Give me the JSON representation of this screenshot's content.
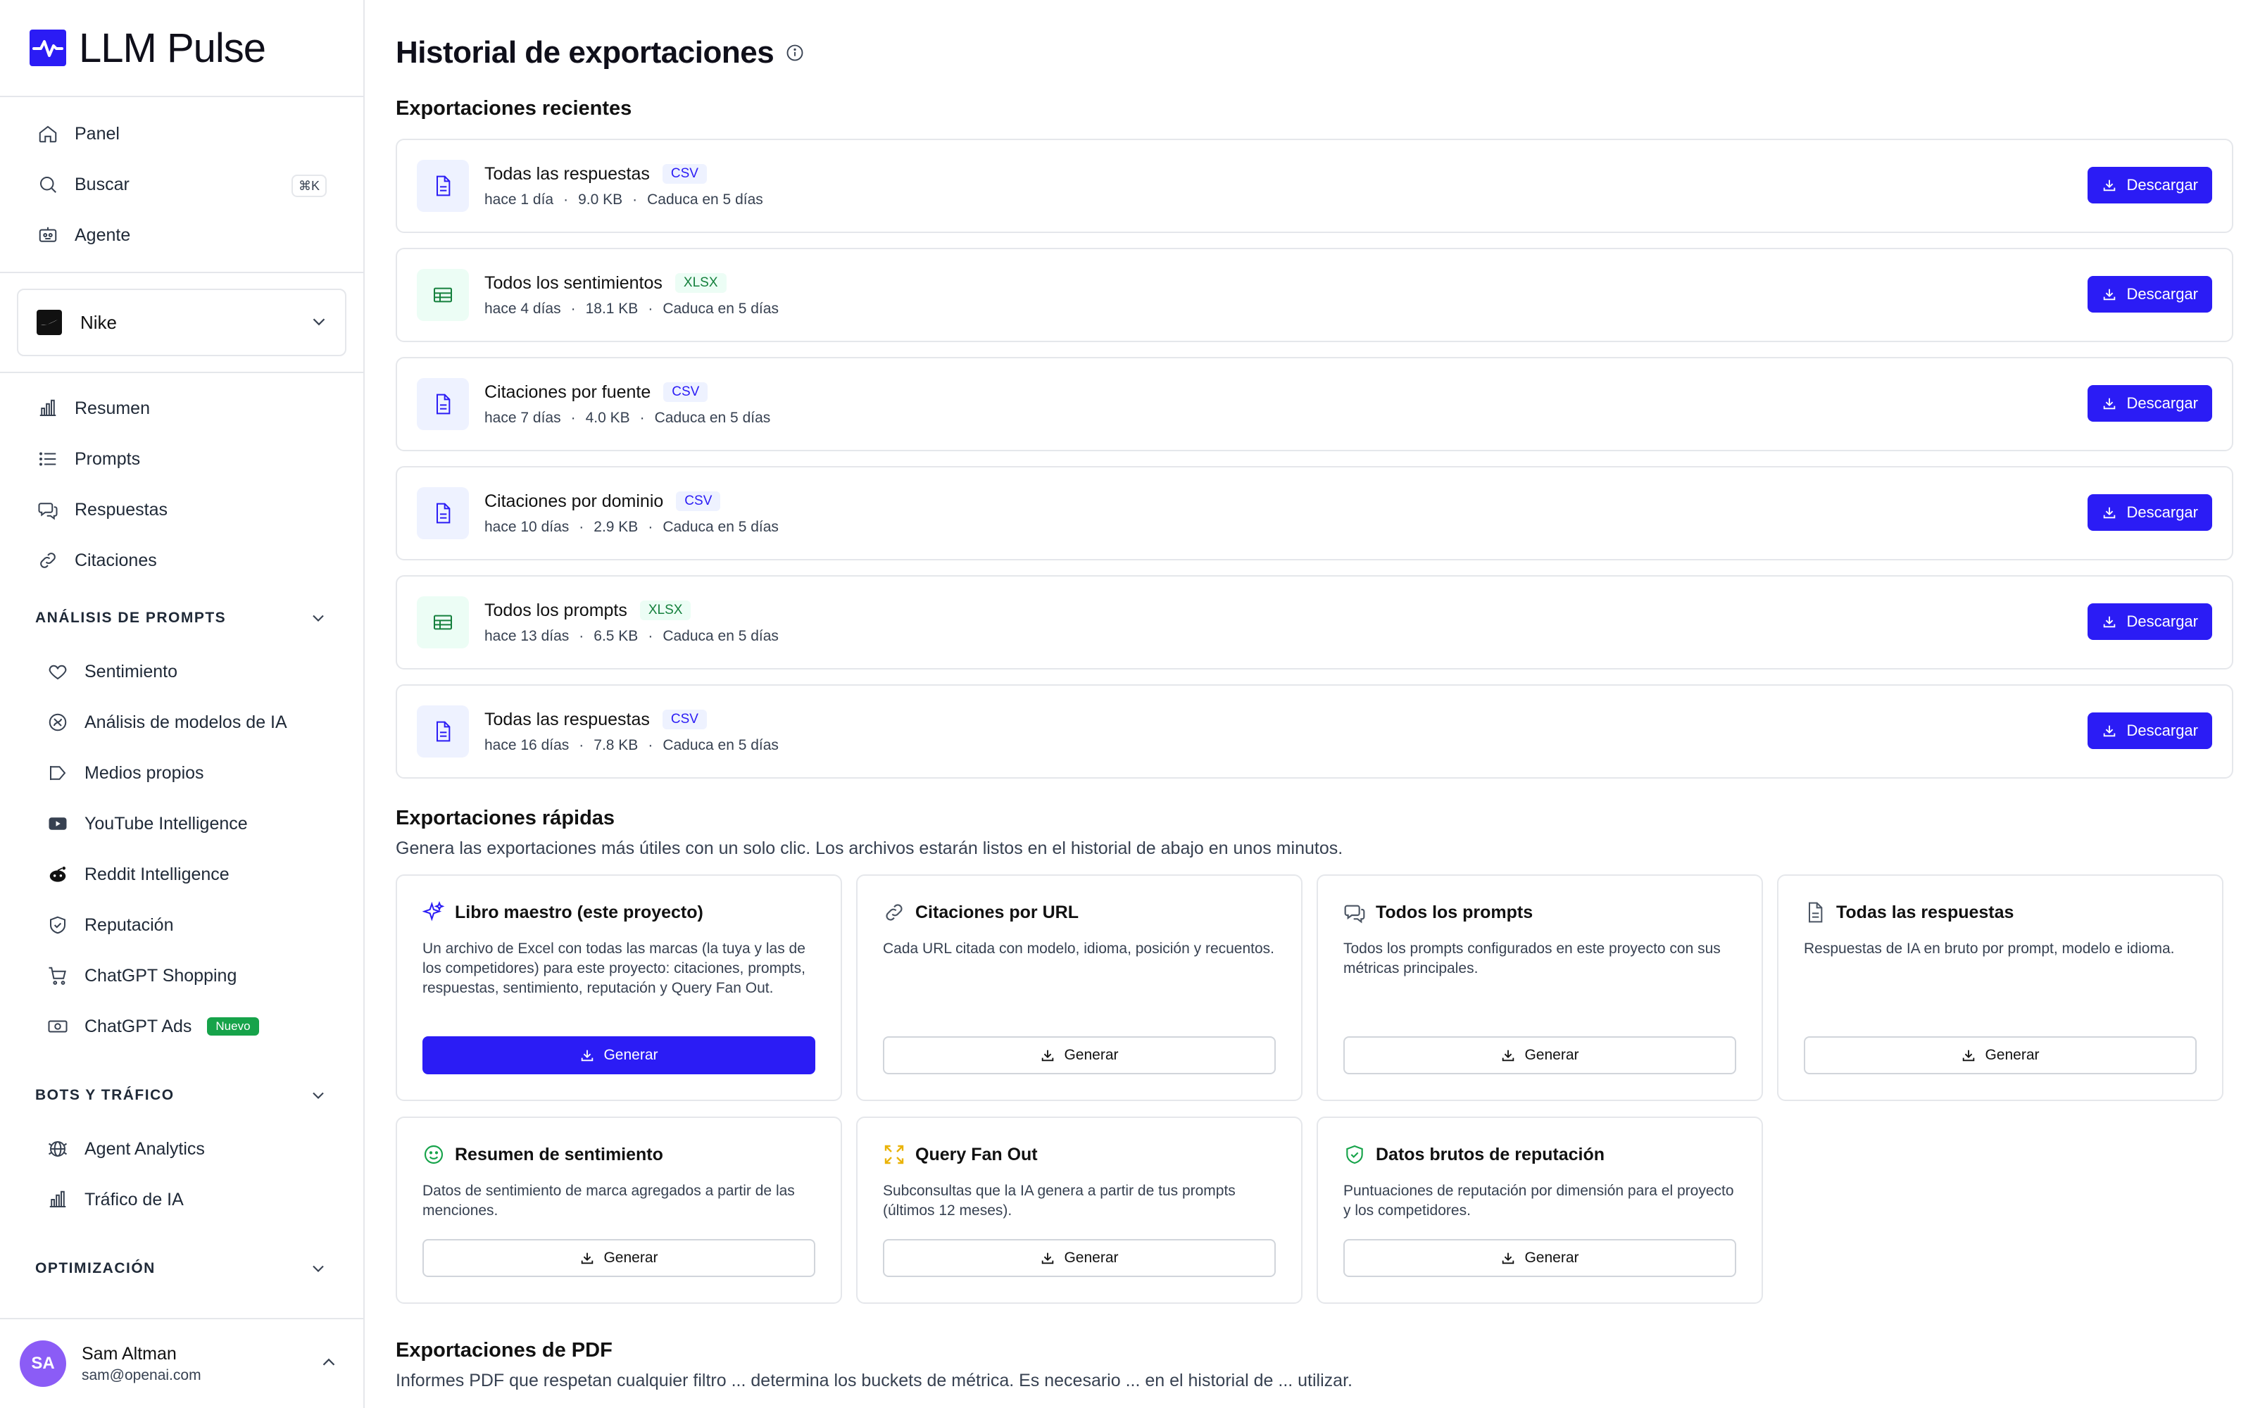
{
  "app": {
    "name": "LLM Pulse",
    "brand_color": "#2b1cf5"
  },
  "nav_top": [
    {
      "label": "Panel",
      "icon": "home-icon"
    },
    {
      "label": "Buscar",
      "icon": "search-icon",
      "shortcut": "⌘K"
    },
    {
      "label": "Agente",
      "icon": "robot-icon"
    }
  ],
  "project": {
    "name": "Nike"
  },
  "nav_main": [
    {
      "label": "Resumen",
      "icon": "bar-chart-icon"
    },
    {
      "label": "Prompts",
      "icon": "list-icon"
    },
    {
      "label": "Respuestas",
      "icon": "chat-icon"
    },
    {
      "label": "Citaciones",
      "icon": "link-icon"
    }
  ],
  "sections": {
    "prompt_analysis": {
      "title": "ANÁLISIS DE PROMPTS",
      "items": [
        {
          "label": "Sentimiento",
          "icon": "heart-icon"
        },
        {
          "label": "Análisis de modelos de IA",
          "icon": "ai-model-icon"
        },
        {
          "label": "Medios propios",
          "icon": "megaphone-icon"
        },
        {
          "label": "YouTube Intelligence",
          "icon": "youtube-icon"
        },
        {
          "label": "Reddit Intelligence",
          "icon": "reddit-icon"
        },
        {
          "label": "Reputación",
          "icon": "shield-icon"
        },
        {
          "label": "ChatGPT Shopping",
          "icon": "cart-icon"
        },
        {
          "label": "ChatGPT Ads",
          "icon": "money-icon",
          "badge": "Nuevo"
        }
      ]
    },
    "bots": {
      "title": "BOTS Y TRÁFICO",
      "items": [
        {
          "label": "Agent Analytics",
          "icon": "globe-icon"
        },
        {
          "label": "Tráfico de IA",
          "icon": "bar-chart-icon"
        }
      ]
    },
    "optimization": {
      "title": "OPTIMIZACIÓN"
    }
  },
  "user": {
    "initials": "SA",
    "name": "Sam Altman",
    "email": "sam@openai.com"
  },
  "page": {
    "title": "Historial de exportaciones"
  },
  "recent": {
    "title": "Exportaciones recientes",
    "download_label": "Descargar",
    "items": [
      {
        "name": "Todas las respuestas",
        "format": "CSV",
        "age": "hace 1 día",
        "size": "9.0 KB",
        "expires": "Caduca en 5 días"
      },
      {
        "name": "Todos los sentimientos",
        "format": "XLSX",
        "age": "hace 4 días",
        "size": "18.1 KB",
        "expires": "Caduca en 5 días"
      },
      {
        "name": "Citaciones por fuente",
        "format": "CSV",
        "age": "hace 7 días",
        "size": "4.0 KB",
        "expires": "Caduca en 5 días"
      },
      {
        "name": "Citaciones por dominio",
        "format": "CSV",
        "age": "hace 10 días",
        "size": "2.9 KB",
        "expires": "Caduca en 5 días"
      },
      {
        "name": "Todos los prompts",
        "format": "XLSX",
        "age": "hace 13 días",
        "size": "6.5 KB",
        "expires": "Caduca en 5 días"
      },
      {
        "name": "Todas las respuestas",
        "format": "CSV",
        "age": "hace 16 días",
        "size": "7.8 KB",
        "expires": "Caduca en 5 días"
      }
    ]
  },
  "quick": {
    "title": "Exportaciones rápidas",
    "subtitle": "Genera las exportaciones más útiles con un solo clic. Los archivos estarán listos en el historial de abajo en unos minutos.",
    "generate_label": "Generar",
    "cards": [
      {
        "title": "Libro maestro (este proyecto)",
        "icon": "sparkles-icon",
        "desc": "Un archivo de Excel con todas las marcas (la tuya y las de los competidores) para este proyecto: citaciones, prompts, respuestas, sentimiento, reputación y Query Fan Out."
      },
      {
        "title": "Citaciones por URL",
        "icon": "link-icon",
        "desc": "Cada URL citada con modelo, idioma, posición y recuentos."
      },
      {
        "title": "Todos los prompts",
        "icon": "chat-icon",
        "desc": "Todos los prompts configurados en este proyecto con sus métricas principales."
      },
      {
        "title": "Todas las respuestas",
        "icon": "document-icon",
        "desc": "Respuestas de IA en bruto por prompt, modelo e idioma."
      },
      {
        "title": "Resumen de sentimiento",
        "icon": "smile-icon",
        "desc": "Datos de sentimiento de marca agregados a partir de las menciones."
      },
      {
        "title": "Query Fan Out",
        "icon": "expand-icon",
        "desc": "Subconsultas que la IA genera a partir de tus prompts (últimos 12 meses)."
      },
      {
        "title": "Datos brutos de reputación",
        "icon": "shield-check-icon",
        "desc": "Puntuaciones de reputación por dimensión para el proyecto y los competidores."
      }
    ]
  },
  "pdf": {
    "title": "Exportaciones de PDF",
    "subtitle": "Informes PDF que respetan cualquier filtro ... determina los buckets de métrica. Es necesario ... en el historial de ... utilizar."
  }
}
